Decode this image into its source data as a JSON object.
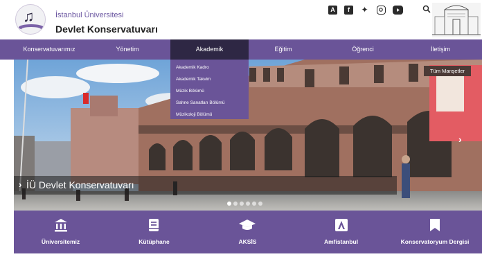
{
  "header": {
    "university": "İstanbul Üniversitesi",
    "department": "Devlet Konservatuvarı",
    "social_icons": [
      "a-icon",
      "facebook-icon",
      "twitter-icon",
      "instagram-icon",
      "youtube-icon"
    ]
  },
  "nav": {
    "items": [
      {
        "label": "Konservatuvarımız"
      },
      {
        "label": "Yönetim"
      },
      {
        "label": "Akademik",
        "active": true
      },
      {
        "label": "Eğitim"
      },
      {
        "label": "Öğrenci"
      },
      {
        "label": "İletişim"
      }
    ],
    "dropdown": [
      {
        "label": "Akademik Kadro"
      },
      {
        "label": "Akademik Takvim"
      },
      {
        "label": "Müzik Bölümü"
      },
      {
        "label": "Sahne Sanatları Bölümü"
      },
      {
        "label": "Müzikoloji Bölümü"
      }
    ]
  },
  "slider": {
    "all_headlines": "Tüm Manşetler",
    "caption": "İÜ Devlet Konservatuvarı",
    "slide_count": 6,
    "active_slide": 1
  },
  "quicklinks": [
    {
      "label": "Üniversitemiz",
      "icon": "university-building-icon"
    },
    {
      "label": "Kütüphane",
      "icon": "book-icon"
    },
    {
      "label": "AKSİS",
      "icon": "graduation-cap-icon"
    },
    {
      "label": "Amfistanbul",
      "icon": "a-logo-icon"
    },
    {
      "label": "Konservatoryum Dergisi",
      "icon": "bookmark-icon"
    }
  ],
  "colors": {
    "brand_purple": "#6a5498",
    "active_nav": "#2e2744"
  }
}
